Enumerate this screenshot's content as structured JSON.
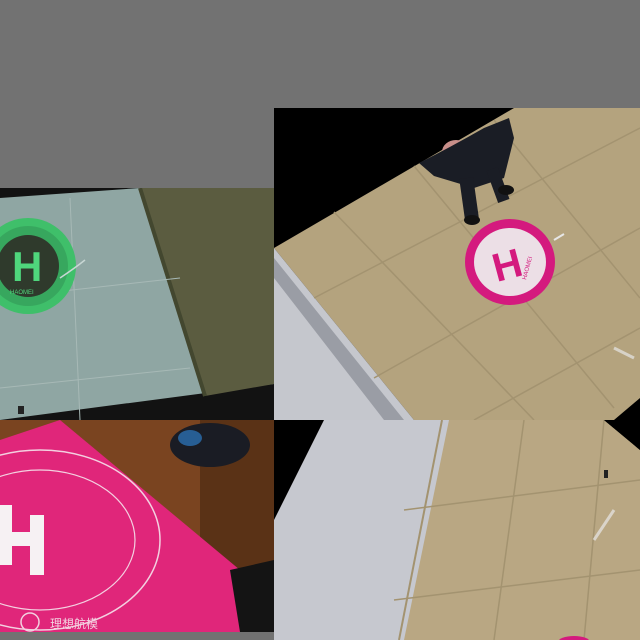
{
  "image": {
    "kind": "mosaic of four overhead photos of drone landing pads",
    "background_color": "#727272"
  },
  "tiles": [
    {
      "id": "green-pad",
      "pad_letter": "H",
      "pad_color": "#3fbf6a",
      "floor": "pale blue-grey tiled floor with olive wall",
      "small_label": "HAOMEI"
    },
    {
      "id": "pink-pad-with-person",
      "pad_letter": "H",
      "pad_color": "#d41a7e",
      "floor": "beige tiled floor, white wall on left",
      "small_label": "HAOMEI"
    },
    {
      "id": "pink-pad-closeup",
      "pad_letter": "H",
      "pad_color": "#e0267a",
      "floor": "wooden table surface",
      "logo_text": "理想航模"
    },
    {
      "id": "empty-floor",
      "floor": "beige tiled floor, white wall on left",
      "pad_color": "#d41a7e"
    }
  ]
}
